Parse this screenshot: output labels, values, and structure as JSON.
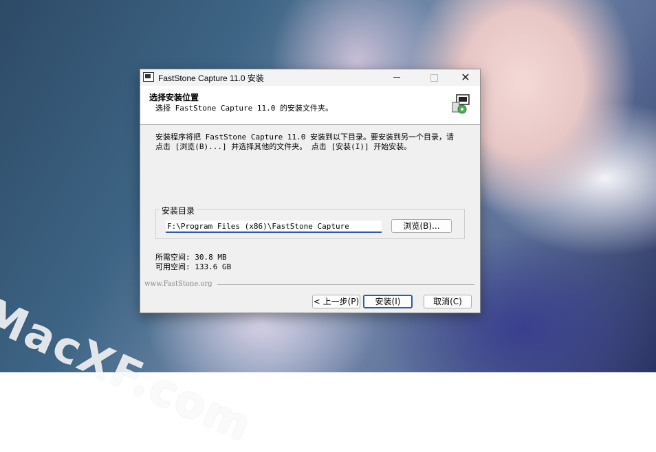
{
  "window": {
    "title": "FastStone Capture 11.0 安装"
  },
  "header": {
    "title": "选择安装位置",
    "subtitle": "选择 FastStone Capture 11.0 的安装文件夹。"
  },
  "instructions": {
    "line1": "安装程序将把 FastStone Capture 11.0 安装到以下目录。要安装到另一个目录，请",
    "line2": "点击 [浏览(B)...] 并选择其他的文件夹。 点击 [安装(I)] 开始安装。"
  },
  "install_dir": {
    "label": "安装目录",
    "value": "F:\\Program Files (x86)\\FastStone Capture",
    "browse_label": "浏览(B)..."
  },
  "space": {
    "required": "所需空间: 30.8 MB",
    "available": "可用空间: 133.6 GB"
  },
  "brand": "www.FastStone.org",
  "buttons": {
    "back": "< 上一步(P)",
    "install": "安装(I)",
    "cancel": "取消(C)"
  },
  "watermark": "MacXF.com",
  "colors": {
    "accent": "#2a5caa",
    "dialog_bg": "#f0f0f0"
  },
  "icons": [
    "app-icon",
    "minimize-icon",
    "maximize-icon",
    "close-icon",
    "installer-icon"
  ]
}
